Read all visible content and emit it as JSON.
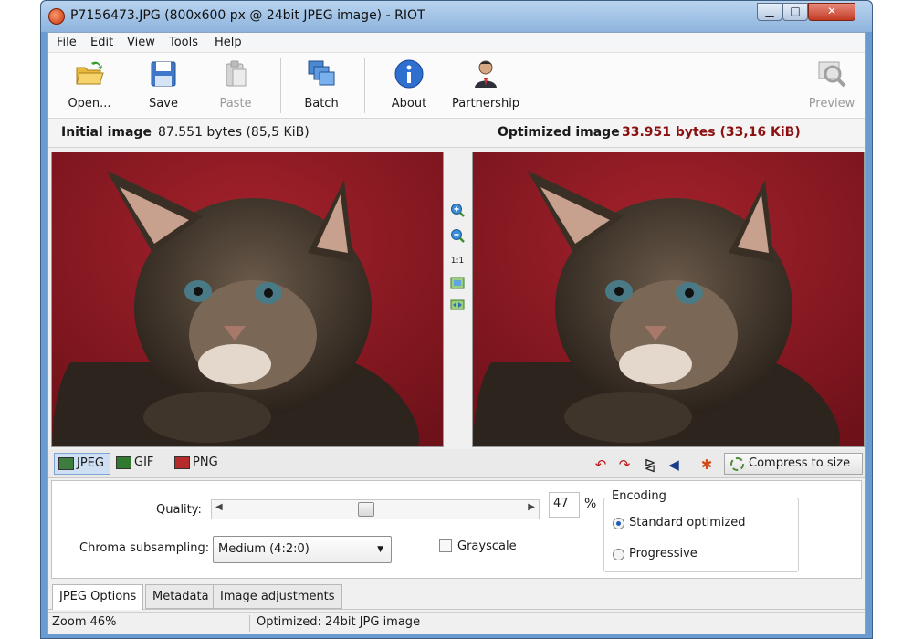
{
  "window": {
    "title": "P7156473.JPG (800x600 px @ 24bit JPEG image) - RIOT",
    "minimize": "▁",
    "maximize": "□",
    "close": "✕"
  },
  "menu": [
    "File",
    "Edit",
    "View",
    "Tools",
    "Help"
  ],
  "toolbar": {
    "open": "Open...",
    "save": "Save",
    "paste": "Paste",
    "batch": "Batch",
    "about": "About",
    "partnership": "Partnership",
    "preview": "Preview"
  },
  "images": {
    "initial_label": "Initial image",
    "initial_size": "87.551 bytes (85,5 KiB)",
    "optimized_label": "Optimized image",
    "optimized_size": "33.951 bytes (33,16 KiB)"
  },
  "zoom_controls": {
    "one_to_one": "1:1"
  },
  "formats": [
    "JPEG",
    "GIF",
    "PNG"
  ],
  "active_format": "JPEG",
  "compress_button": "Compress to size",
  "options": {
    "quality_label": "Quality:",
    "quality_value": "47",
    "quality_unit": "%",
    "chroma_label": "Chroma subsampling:",
    "chroma_value": "Medium (4:2:0)",
    "grayscale_label": "Grayscale",
    "encoding_title": "Encoding",
    "encoding_options": [
      "Standard optimized",
      "Progressive"
    ],
    "encoding_selected": "Standard optimized"
  },
  "bottom_tabs": [
    "JPEG Options",
    "Metadata",
    "Image adjustments"
  ],
  "status": {
    "zoom": "Zoom 46%",
    "info": "Optimized: 24bit JPG image"
  },
  "colors": {
    "accent": "#1e5fb3",
    "optimized_size": "#8b1010",
    "rotate_icons": "#c01818"
  }
}
